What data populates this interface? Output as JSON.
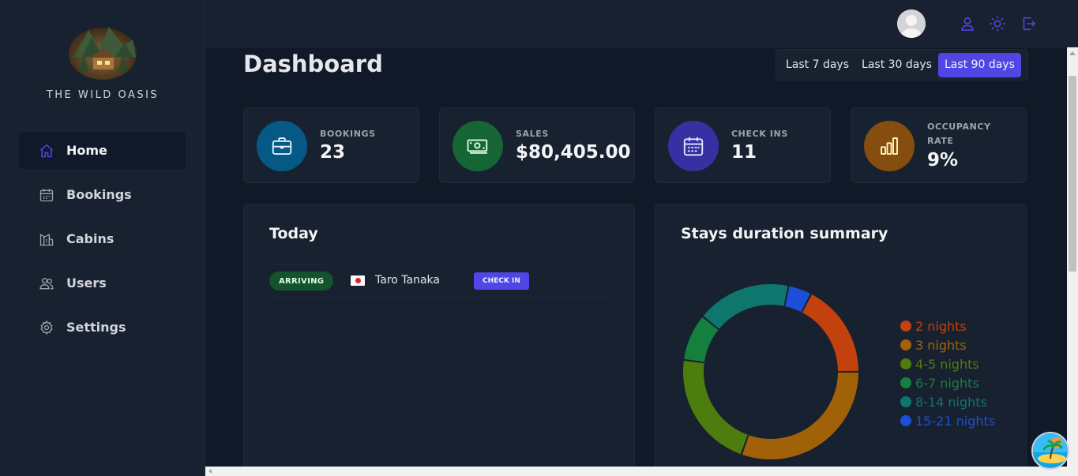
{
  "brand": {
    "name": "THE WILD OASIS"
  },
  "sidebar": {
    "items": [
      {
        "label": "Home",
        "icon": "home-icon",
        "active": true
      },
      {
        "label": "Bookings",
        "icon": "calendar-icon"
      },
      {
        "label": "Cabins",
        "icon": "cabin-icon"
      },
      {
        "label": "Users",
        "icon": "users-icon"
      },
      {
        "label": "Settings",
        "icon": "gear-icon"
      }
    ]
  },
  "header": {
    "icons": [
      "user-icon",
      "sun-icon",
      "logout-icon"
    ]
  },
  "page": {
    "title": "Dashboard"
  },
  "filter": {
    "options": [
      "Last 7 days",
      "Last 30 days",
      "Last 90 days"
    ],
    "selected": "Last 90 days"
  },
  "stats": [
    {
      "label": "Bookings",
      "value": "23",
      "icon": "briefcase-icon",
      "color": "#075985",
      "iconColor": "#e0f2fe"
    },
    {
      "label": "Sales",
      "value": "$80,405.00",
      "icon": "banknotes-icon",
      "color": "#166534",
      "iconColor": "#dcfce7"
    },
    {
      "label": "Check ins",
      "value": "11",
      "icon": "calendar-days-icon",
      "color": "#3730a3",
      "iconColor": "#e0e7ff"
    },
    {
      "label": "Occupancy rate",
      "value": "9%",
      "icon": "chart-bar-icon",
      "color": "#854d0e",
      "iconColor": "#fef9c3"
    }
  ],
  "today": {
    "title": "Today",
    "activities": [
      {
        "status": "ARRIVING",
        "guest": "Taro Tanaka",
        "action": "CHECK IN"
      }
    ]
  },
  "stays": {
    "title": "Stays duration summary",
    "chart_data": {
      "type": "pie",
      "variant": "donut",
      "categories": [
        "2 nights",
        "3 nights",
        "4-5 nights",
        "6-7 nights",
        "8-14 nights",
        "15-21 nights"
      ],
      "values": [
        4,
        7,
        5,
        2,
        4,
        1
      ],
      "colors": [
        "#c2410c",
        "#a16207",
        "#4d7c0f",
        "#15803d",
        "#0f766e",
        "#1d4ed8"
      ],
      "legend": "right"
    }
  }
}
